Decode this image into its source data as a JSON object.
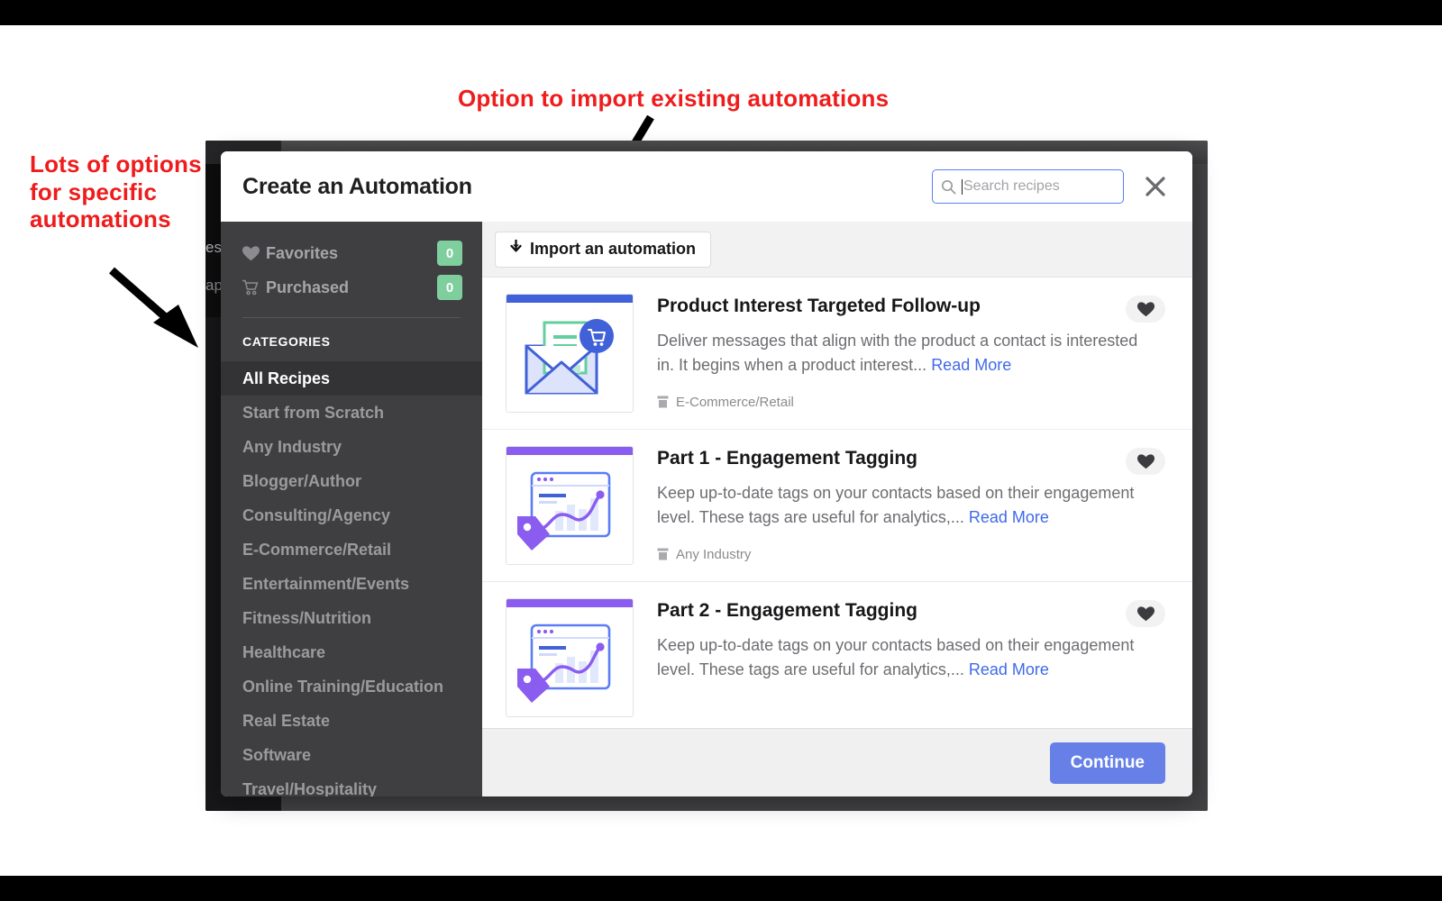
{
  "annotations": {
    "top": "Option to import existing automations",
    "left": "Lots of options for specific automations",
    "color": "#ee1c1c"
  },
  "background_app": {
    "fragment_1": "es",
    "fragment_2": "ap"
  },
  "modal": {
    "title": "Create an Automation",
    "search": {
      "placeholder": "Search recipes",
      "value": "",
      "icon": "search-icon",
      "focused": true,
      "focus_color": "#5b7df5"
    },
    "close_icon": "close-icon",
    "nav": {
      "quick": [
        {
          "label": "Favorites",
          "count": "0",
          "icon": "heart-icon"
        },
        {
          "label": "Purchased",
          "count": "0",
          "icon": "shopping-cart-icon"
        }
      ],
      "badge_color": "#7fcf9e",
      "heading": "CATEGORIES",
      "categories": [
        {
          "label": "All Recipes",
          "active": true
        },
        {
          "label": "Start from Scratch",
          "active": false
        },
        {
          "label": "Any Industry",
          "active": false
        },
        {
          "label": "Blogger/Author",
          "active": false
        },
        {
          "label": "Consulting/Agency",
          "active": false
        },
        {
          "label": "E-Commerce/Retail",
          "active": false
        },
        {
          "label": "Entertainment/Events",
          "active": false
        },
        {
          "label": "Fitness/Nutrition",
          "active": false
        },
        {
          "label": "Healthcare",
          "active": false
        },
        {
          "label": "Online Training/Education",
          "active": false
        },
        {
          "label": "Real Estate",
          "active": false
        },
        {
          "label": "Software",
          "active": false
        },
        {
          "label": "Travel/Hospitality",
          "active": false
        }
      ]
    },
    "import_button": {
      "label": "Import an automation",
      "icon": "download-arrow-icon"
    },
    "recipes": [
      {
        "title": "Product Interest Targeted Follow-up",
        "description": "Deliver messages that align with the product a contact is interested in. It begins when a product interest...",
        "read_more": "Read More",
        "tag": "E-Commerce/Retail",
        "tag_icon": "category-icon",
        "favorite_icon": "heart-icon",
        "thumb_accent": "#4161d8",
        "thumb_art": "envelope-cart"
      },
      {
        "title": "Part 1 - Engagement Tagging",
        "description": "Keep up-to-date tags on your contacts based on their engagement level. These tags are useful for analytics,...",
        "read_more": "Read More",
        "tag": "Any Industry",
        "tag_icon": "category-icon",
        "favorite_icon": "heart-icon",
        "thumb_accent": "#8a5cf0",
        "thumb_art": "tag-chart"
      },
      {
        "title": "Part 2 - Engagement Tagging",
        "description": "Keep up-to-date tags on your contacts based on their engagement level. These tags are useful for analytics,...",
        "read_more": "Read More",
        "tag": "",
        "tag_icon": "category-icon",
        "favorite_icon": "heart-icon",
        "thumb_accent": "#8a5cf0",
        "thumb_art": "tag-chart"
      }
    ],
    "footer": {
      "continue_label": "Continue",
      "continue_color": "#6680e8"
    }
  }
}
